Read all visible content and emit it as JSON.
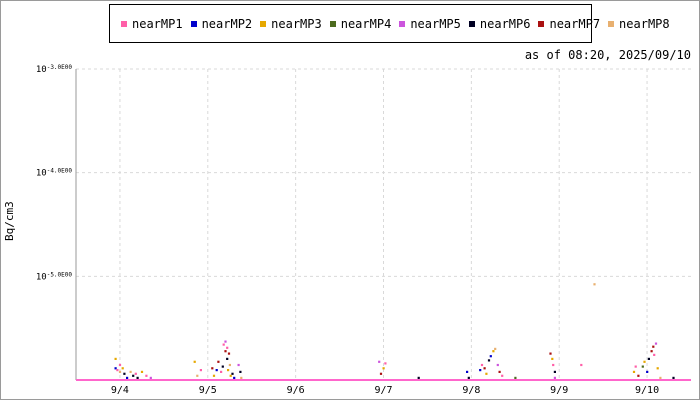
{
  "as_of": "as of 08:20, 2025/09/10",
  "colors": {
    "grid": "#d9d9d9",
    "axis": "#9a9a9a",
    "baseline": "#ff66cc"
  },
  "chart_data": {
    "type": "scatter",
    "title": "",
    "xlabel": "",
    "ylabel": "Bq/cm3",
    "y_scale": "log",
    "ylim": [
      1e-06,
      0.001
    ],
    "y_ticks": [
      {
        "value": 0.001,
        "label": "10-3.0E00"
      },
      {
        "value": 0.0001,
        "label": "10-4.0E00"
      },
      {
        "value": 1e-05,
        "label": "10-5.0E00"
      }
    ],
    "x_range": [
      "9/3 12:00",
      "9/10 12:00"
    ],
    "x_ticks": [
      "9/4",
      "9/5",
      "9/6",
      "9/7",
      "9/8",
      "9/9",
      "9/10"
    ],
    "grid": true,
    "legend_position": "top",
    "series": [
      {
        "name": "nearMP1",
        "color": "#ff5fa8"
      },
      {
        "name": "nearMP2",
        "color": "#0000cc"
      },
      {
        "name": "nearMP3",
        "color": "#e6a800"
      },
      {
        "name": "nearMP4",
        "color": "#4d6b1f"
      },
      {
        "name": "nearMP5",
        "color": "#cc55dd"
      },
      {
        "name": "nearMP6",
        "color": "#000022"
      },
      {
        "name": "nearMP7",
        "color": "#aa1111"
      },
      {
        "name": "nearMP8",
        "color": "#e8b070"
      }
    ],
    "points": [
      {
        "t": 3.95,
        "y": 1.6e-06,
        "s": 2
      },
      {
        "t": 3.95,
        "y": 1.3e-06,
        "s": 1
      },
      {
        "t": 3.97,
        "y": 1.25e-06,
        "s": 0
      },
      {
        "t": 4.0,
        "y": 1.4e-06,
        "s": 0
      },
      {
        "t": 4.0,
        "y": 1.2e-06,
        "s": 7
      },
      {
        "t": 4.03,
        "y": 1.3e-06,
        "s": 2
      },
      {
        "t": 4.05,
        "y": 1.15e-06,
        "s": 5
      },
      {
        "t": 4.08,
        "y": 1.05e-06,
        "s": 1
      },
      {
        "t": 4.12,
        "y": 1.2e-06,
        "s": 7
      },
      {
        "t": 4.15,
        "y": 1.1e-06,
        "s": 5
      },
      {
        "t": 4.18,
        "y": 1.15e-06,
        "s": 0
      },
      {
        "t": 4.2,
        "y": 1.05e-06,
        "s": 5
      },
      {
        "t": 4.25,
        "y": 1.2e-06,
        "s": 2
      },
      {
        "t": 4.3,
        "y": 1.1e-06,
        "s": 0
      },
      {
        "t": 4.35,
        "y": 1.05e-06,
        "s": 4
      },
      {
        "t": 4.85,
        "y": 1.5e-06,
        "s": 2
      },
      {
        "t": 4.88,
        "y": 1.1e-06,
        "s": 7
      },
      {
        "t": 4.92,
        "y": 1.25e-06,
        "s": 0
      },
      {
        "t": 5.05,
        "y": 1.3e-06,
        "s": 6
      },
      {
        "t": 5.07,
        "y": 1.1e-06,
        "s": 2
      },
      {
        "t": 5.1,
        "y": 1.25e-06,
        "s": 1
      },
      {
        "t": 5.12,
        "y": 1.5e-06,
        "s": 6
      },
      {
        "t": 5.15,
        "y": 1.2e-06,
        "s": 0
      },
      {
        "t": 5.17,
        "y": 1.35e-06,
        "s": 5
      },
      {
        "t": 5.18,
        "y": 2.2e-06,
        "s": 0
      },
      {
        "t": 5.2,
        "y": 2.35e-06,
        "s": 4
      },
      {
        "t": 5.2,
        "y": 1.9e-06,
        "s": 6
      },
      {
        "t": 5.22,
        "y": 1.6e-06,
        "s": 5
      },
      {
        "t": 5.22,
        "y": 2.05e-06,
        "s": 0
      },
      {
        "t": 5.23,
        "y": 1.25e-06,
        "s": 2
      },
      {
        "t": 5.24,
        "y": 1.8e-06,
        "s": 6
      },
      {
        "t": 5.25,
        "y": 1.4e-06,
        "s": 7
      },
      {
        "t": 5.26,
        "y": 1.1e-06,
        "s": 2
      },
      {
        "t": 5.28,
        "y": 1.15e-06,
        "s": 5
      },
      {
        "t": 5.3,
        "y": 1.05e-06,
        "s": 1
      },
      {
        "t": 5.35,
        "y": 1.4e-06,
        "s": 4
      },
      {
        "t": 5.37,
        "y": 1.2e-06,
        "s": 5
      },
      {
        "t": 5.38,
        "y": 1.05e-06,
        "s": 7
      },
      {
        "t": 6.95,
        "y": 1.5e-06,
        "s": 4
      },
      {
        "t": 6.97,
        "y": 1.15e-06,
        "s": 6
      },
      {
        "t": 7.0,
        "y": 1.3e-06,
        "s": 2
      },
      {
        "t": 7.02,
        "y": 1.45e-06,
        "s": 0
      },
      {
        "t": 7.4,
        "y": 1.05e-06,
        "s": 5
      },
      {
        "t": 7.95,
        "y": 1.2e-06,
        "s": 1
      },
      {
        "t": 7.97,
        "y": 1.05e-06,
        "s": 5
      },
      {
        "t": 8.1,
        "y": 1.25e-06,
        "s": 1
      },
      {
        "t": 8.12,
        "y": 1.4e-06,
        "s": 0
      },
      {
        "t": 8.15,
        "y": 1.3e-06,
        "s": 6
      },
      {
        "t": 8.17,
        "y": 1.15e-06,
        "s": 2
      },
      {
        "t": 8.2,
        "y": 1.55e-06,
        "s": 5
      },
      {
        "t": 8.22,
        "y": 1.7e-06,
        "s": 1
      },
      {
        "t": 8.25,
        "y": 1.9e-06,
        "s": 2
      },
      {
        "t": 8.27,
        "y": 2e-06,
        "s": 7
      },
      {
        "t": 8.3,
        "y": 1.4e-06,
        "s": 4
      },
      {
        "t": 8.32,
        "y": 1.2e-06,
        "s": 6
      },
      {
        "t": 8.35,
        "y": 1.1e-06,
        "s": 0
      },
      {
        "t": 8.5,
        "y": 1.05e-06,
        "s": 3
      },
      {
        "t": 8.9,
        "y": 1.8e-06,
        "s": 6
      },
      {
        "t": 8.92,
        "y": 1.6e-06,
        "s": 2
      },
      {
        "t": 8.93,
        "y": 1.4e-06,
        "s": 0
      },
      {
        "t": 8.95,
        "y": 1.2e-06,
        "s": 5
      },
      {
        "t": 8.95,
        "y": 1.05e-06,
        "s": 4
      },
      {
        "t": 9.25,
        "y": 1.4e-06,
        "s": 0
      },
      {
        "t": 9.4,
        "y": 8.4e-06,
        "s": 7
      },
      {
        "t": 9.85,
        "y": 1.2e-06,
        "s": 2
      },
      {
        "t": 9.87,
        "y": 1.35e-06,
        "s": 0
      },
      {
        "t": 9.9,
        "y": 1.1e-06,
        "s": 6
      },
      {
        "t": 9.95,
        "y": 1.35e-06,
        "s": 3
      },
      {
        "t": 9.97,
        "y": 1.5e-06,
        "s": 2
      },
      {
        "t": 10.0,
        "y": 1.2e-06,
        "s": 1
      },
      {
        "t": 10.02,
        "y": 1.6e-06,
        "s": 5
      },
      {
        "t": 10.05,
        "y": 1.9e-06,
        "s": 6
      },
      {
        "t": 10.07,
        "y": 2.1e-06,
        "s": 6
      },
      {
        "t": 10.08,
        "y": 1.75e-06,
        "s": 0
      },
      {
        "t": 10.1,
        "y": 2.25e-06,
        "s": 4
      },
      {
        "t": 10.12,
        "y": 1.3e-06,
        "s": 2
      },
      {
        "t": 10.15,
        "y": 1.05e-06,
        "s": 7
      },
      {
        "t": 10.3,
        "y": 1.05e-06,
        "s": 5
      }
    ]
  }
}
